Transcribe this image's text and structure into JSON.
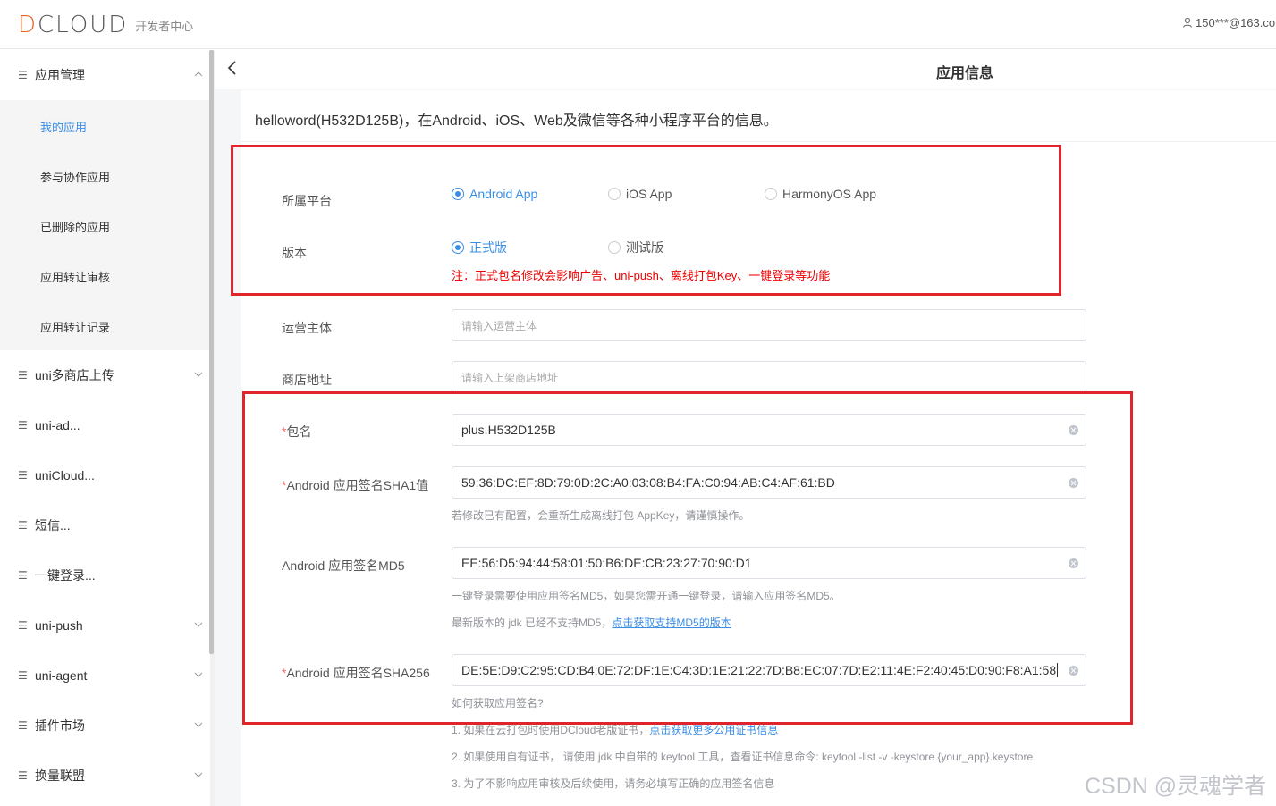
{
  "header": {
    "logo_text": "DCLOUD",
    "subtitle": "开发者中心",
    "user": "150***@163.co"
  },
  "sidebar": {
    "groups": [
      {
        "label": "应用管理"
      },
      {
        "label": "uni多商店上传"
      },
      {
        "label": "uni-ad..."
      },
      {
        "label": "uniCloud..."
      },
      {
        "label": "短信..."
      },
      {
        "label": "一键登录..."
      },
      {
        "label": "uni-push"
      },
      {
        "label": "uni-agent"
      },
      {
        "label": "插件市场"
      },
      {
        "label": "换量联盟"
      }
    ],
    "sub_items": [
      {
        "label": "我的应用",
        "active": true
      },
      {
        "label": "参与协作应用"
      },
      {
        "label": "已删除的应用"
      },
      {
        "label": "应用转让审核"
      },
      {
        "label": "应用转让记录"
      }
    ]
  },
  "page": {
    "title": "应用信息",
    "info": "helloword(H532D125B)，在Android、iOS、Web及微信等各种小程序平台的信息。"
  },
  "form": {
    "platform_label": "所属平台",
    "platforms": [
      "Android App",
      "iOS App",
      "HarmonyOS App"
    ],
    "platform_selected": "Android App",
    "version_label": "版本",
    "versions": [
      "正式版",
      "测试版"
    ],
    "version_selected": "正式版",
    "version_warning": "注：正式包名修改会影响广告、uni-push、离线打包Key、一键登录等功能",
    "operator_label": "运营主体",
    "operator_placeholder": "请输入运营主体",
    "store_label": "商店地址",
    "store_placeholder": "请输入上架商店地址",
    "package_label": "包名",
    "package_value": "plus.H532D125B",
    "sha1_label": "Android 应用签名SHA1值",
    "sha1_value": "59:36:DC:EF:8D:79:0D:2C:A0:03:08:B4:FA:C0:94:AB:C4:AF:61:BD",
    "sha1_hint": "若修改已有配置，会重新生成离线打包 AppKey，请谨慎操作。",
    "md5_label": "Android 应用签名MD5",
    "md5_value": "EE:56:D5:94:44:58:01:50:B6:DE:CB:23:27:70:90:D1",
    "md5_hint1": "一键登录需要使用应用签名MD5，如果您需开通一键登录，请输入应用签名MD5。",
    "md5_hint2": "最新版本的 jdk 已经不支持MD5，",
    "md5_hint2_link": "点击获取支持MD5的版本",
    "sha256_label": "Android 应用签名SHA256",
    "sha256_value": "DE:5E:D9:C2:95:CD:B4:0E:72:DF:1E:C4:3D:1E:21:22:7D:B8:EC:07:7D:E2:11:4E:F2:40:45:D0:90:F8:A1:58",
    "how_to": "如何获取应用签名?",
    "note1": "1. 如果在云打包时使用DCloud老版证书，",
    "note1_link": "点击获取更多公用证书信息",
    "note2": "2. 如果使用自有证书，  请使用 jdk 中自带的 keytool 工具，查看证书信息命令: keytool -list -v -keystore {your_app}.keystore",
    "note3": "3. 为了不影响应用审核及后续使用，请务必填写正确的应用签名信息"
  },
  "watermark": "CSDN @灵魂学者",
  "colors": {
    "accent": "#3a8ee6",
    "highlight_box": "#e0242b",
    "warning": "#e00000"
  }
}
